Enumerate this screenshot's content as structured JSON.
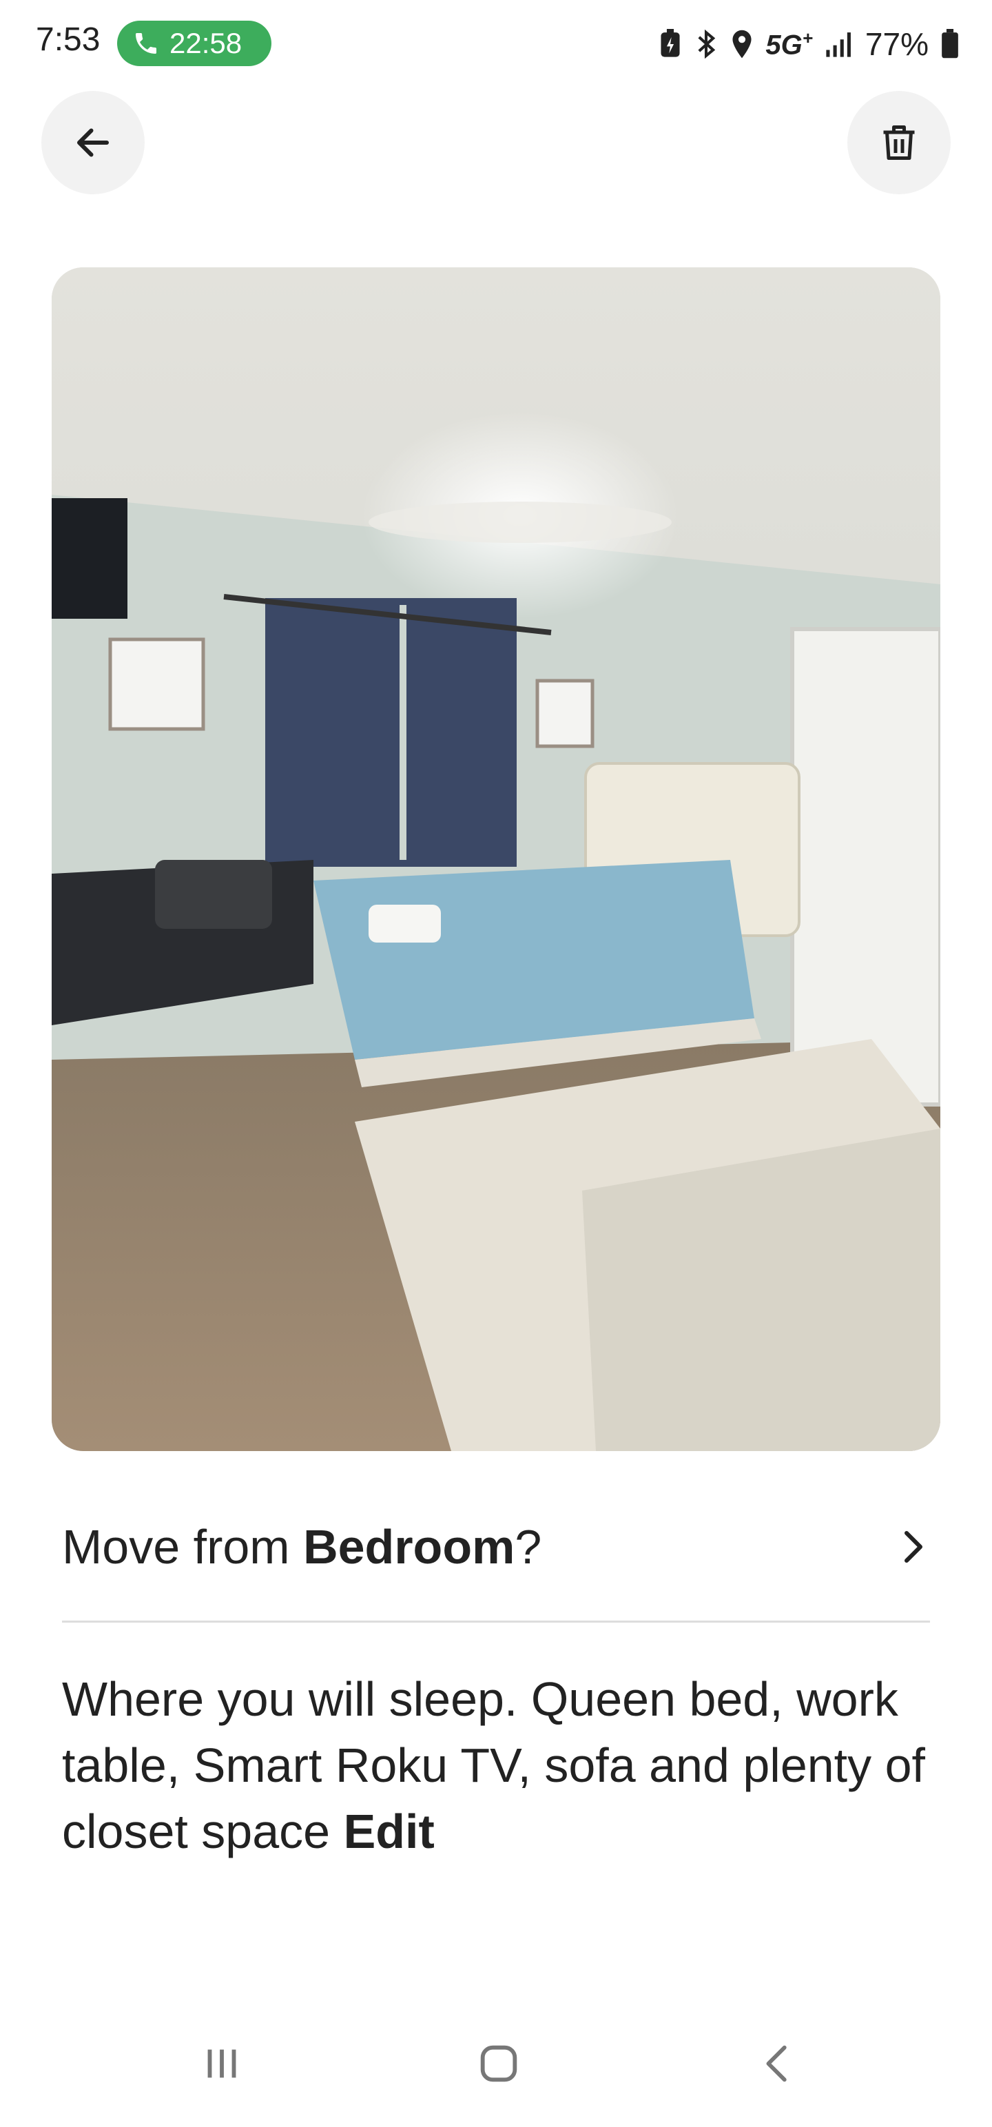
{
  "status_bar": {
    "time": "7:53",
    "call_timer": "22:58",
    "network": "5G",
    "network_plus": "+",
    "battery": "77%",
    "icons": [
      "phone-icon",
      "battery-saver-icon",
      "bluetooth-icon",
      "location-icon",
      "signal-icon",
      "battery-icon"
    ]
  },
  "header": {
    "back_icon": "arrow-left-icon",
    "delete_icon": "trash-icon"
  },
  "photo": {
    "description_icon": "bedroom-photo"
  },
  "move": {
    "prefix": "Move from ",
    "room": "Bedroom",
    "suffix": "?"
  },
  "caption": {
    "text": "Where you will sleep.  Queen bed, work table, Smart Roku TV, sofa and plenty of closet space ",
    "edit_label": "Edit"
  },
  "nav": {
    "icons": [
      "recent-apps-icon",
      "home-icon",
      "back-icon"
    ]
  },
  "colors": {
    "call_pill": "#3dad5c",
    "button_bg": "#f2f2f2",
    "divider": "#dddddd",
    "text": "#222222"
  }
}
